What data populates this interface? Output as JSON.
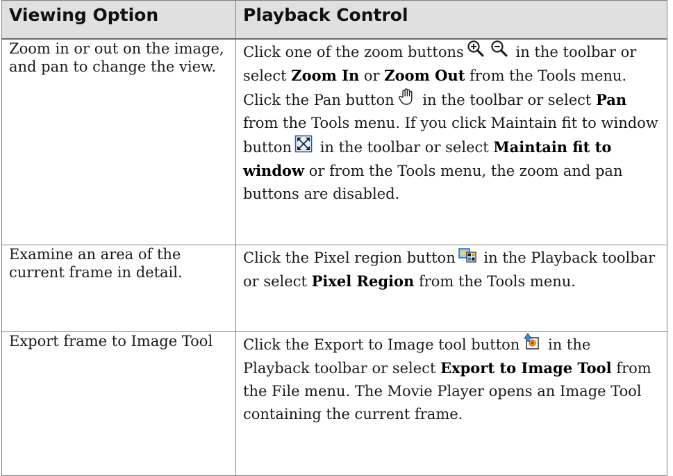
{
  "table": {
    "headers": {
      "option": "Viewing Option",
      "control": "Playback Control"
    },
    "rows": [
      {
        "option": "Zoom in or out on the image, and pan to change the view.",
        "control": [
          "Click one of the zoom buttons",
          "in the toolbar or select",
          "Zoom In",
          "or",
          "Zoom Out",
          "from the Tools menu. Click the Pan button",
          "in the toolbar or select",
          "Pan",
          "from the Tools menu. If you click Maintain fit to window button",
          "in the toolbar or select",
          "Maintain fit to window",
          "or from the Tools menu, the zoom and pan buttons are disabled."
        ],
        "icons": [
          "zoom-in-icon",
          "zoom-out-icon",
          "pan-hand-icon",
          "maintain-fit-to-window-icon"
        ]
      },
      {
        "option": "Examine an area of the current frame in detail.",
        "control": [
          "Click the Pixel region button",
          "in the Playback toolbar or select",
          "Pixel Region",
          "from the Tools menu."
        ],
        "icons": [
          "pixel-region-icon"
        ]
      },
      {
        "option": "Export frame to Image Tool",
        "control": [
          "Click the Export to Image tool button",
          "in the Playback toolbar or select",
          "Export to Image Tool",
          "from the File menu. The Movie Player opens an Image Tool containing the current frame."
        ],
        "icons": [
          "export-to-image-tool-icon"
        ]
      }
    ]
  }
}
